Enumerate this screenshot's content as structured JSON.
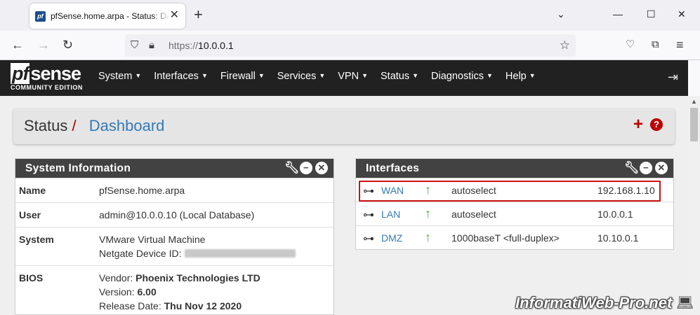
{
  "browser": {
    "tab_title": "pfSense.home.arpa - Status: Dashboard",
    "favicon_text": "pf",
    "url_scheme": "https://",
    "url_host": "10.0.0.1"
  },
  "header": {
    "logo_main": "sense",
    "logo_pf": "pf",
    "logo_sub": "COMMUNITY EDITION",
    "menu": [
      {
        "label": "System"
      },
      {
        "label": "Interfaces"
      },
      {
        "label": "Firewall"
      },
      {
        "label": "Services"
      },
      {
        "label": "VPN"
      },
      {
        "label": "Status"
      },
      {
        "label": "Diagnostics"
      },
      {
        "label": "Help"
      }
    ]
  },
  "breadcrumb": {
    "parent": "Status",
    "separator": "/",
    "current": "Dashboard"
  },
  "system_info": {
    "title": "System Information",
    "rows": [
      {
        "label": "Name",
        "value": "pfSense.home.arpa"
      },
      {
        "label": "User",
        "value": "admin@10.0.0.10 (Local Database)"
      },
      {
        "label": "System",
        "value": "VMware Virtual Machine",
        "value2_label": "Netgate Device ID:"
      },
      {
        "label": "BIOS",
        "vendor_label": "Vendor:",
        "vendor": "Phoenix Technologies LTD",
        "version_label": "Version:",
        "version": "6.00",
        "release_label": "Release Date:",
        "release": "Thu Nov 12 2020"
      }
    ]
  },
  "interfaces": {
    "title": "Interfaces",
    "rows": [
      {
        "name": "WAN",
        "media": "autoselect",
        "ip": "192.168.1.10",
        "status": "up"
      },
      {
        "name": "LAN",
        "media": "autoselect",
        "ip": "10.0.0.1",
        "status": "up"
      },
      {
        "name": "DMZ",
        "media": "1000baseT <full-duplex>",
        "ip": "10.10.0.1",
        "status": "up"
      }
    ]
  },
  "watermark": "InformatiWeb-Pro.net",
  "colors": {
    "header_bg": "#212121",
    "panel_head": "#424242",
    "link": "#337ab7",
    "accent_red": "#bb0000",
    "status_up": "#4cae4c",
    "highlight": "#cc1010"
  },
  "icons": {
    "widget_settings": "wrench-icon",
    "widget_minimize": "minus-circle-icon",
    "widget_close": "close-circle-icon",
    "interface": "network-icon",
    "status_up": "arrow-up-icon",
    "logout": "logout-icon",
    "add": "plus-icon",
    "help": "question-circle-icon"
  }
}
